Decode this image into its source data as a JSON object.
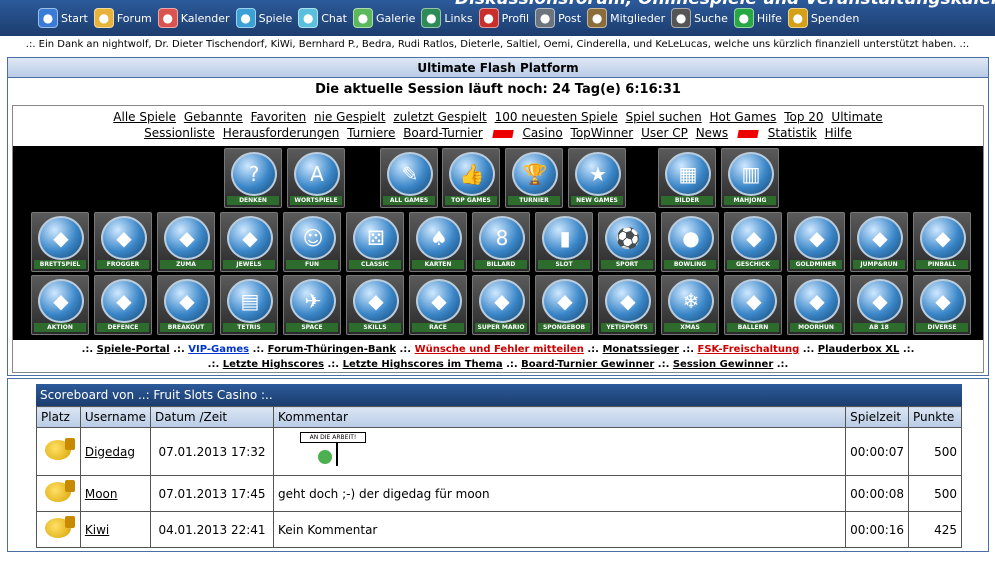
{
  "header": {
    "banner": "Diskussionsforum, Onlinespiele und Veranstaltungskalender für Thüringen",
    "nav": [
      {
        "label": "Start",
        "icon": "start-icon",
        "color": "#3a7bd5"
      },
      {
        "label": "Forum",
        "icon": "folder-icon",
        "color": "#e8b33a"
      },
      {
        "label": "Kalender",
        "icon": "calendar-icon",
        "color": "#d9534f"
      },
      {
        "label": "Spiele",
        "icon": "puzzle-icon",
        "color": "#3aa0d5"
      },
      {
        "label": "Chat",
        "icon": "chat-icon",
        "color": "#5bc0de"
      },
      {
        "label": "Galerie",
        "icon": "image-icon",
        "color": "#5cb85c"
      },
      {
        "label": "Links",
        "icon": "globe-icon",
        "color": "#2e8b57"
      },
      {
        "label": "Profil",
        "icon": "user-icon",
        "color": "#c9302c"
      },
      {
        "label": "Post",
        "icon": "mail-icon",
        "color": "#6c757d"
      },
      {
        "label": "Mitglieder",
        "icon": "members-icon",
        "color": "#8a6d3b"
      },
      {
        "label": "Suche",
        "icon": "binoculars-icon",
        "color": "#555"
      },
      {
        "label": "Hilfe",
        "icon": "help-icon",
        "color": "#28a745"
      },
      {
        "label": "Spenden",
        "icon": "coins-icon",
        "color": "#d4a017"
      }
    ]
  },
  "thanks": ".:. Ein Dank an nightwolf, Dr. Dieter Tischendorf, KiWi, Bernhard P., Bedra, Rudi Ratlos, Dieterle, Saltiel, Oemi, Cinderella, und KeLeLucas, welche uns kürzlich finanziell unterstützt haben. .:.",
  "main": {
    "title": "Ultimate Flash Platform",
    "session": "Die aktuelle Session läuft noch: 24 Tag(e) 6:16:31"
  },
  "links_row1": [
    "Alle Spiele",
    "Gebannte",
    "Favoriten",
    "nie Gespielt",
    "zuletzt Gespielt",
    "100 neuesten Spiele",
    "Spiel suchen",
    "Hot Games",
    "Top 20",
    "Ultimate"
  ],
  "links_row2": [
    "Sessionliste",
    "Herausforderungen",
    "Turniere",
    "Board-Turnier",
    "Casino",
    "TopWinner",
    "User CP",
    "News",
    "Statistik",
    "Hilfe"
  ],
  "games_row1": [
    "DENKEN",
    "WORTSPIELE",
    "ALL GAMES",
    "TOP GAMES",
    "TURNIER",
    "NEW GAMES",
    "BILDER",
    "MAHJONG"
  ],
  "games_row2": [
    "BRETTSPIEL",
    "FROGGER",
    "ZUMA",
    "JEWELS",
    "FUN",
    "CLASSIC",
    "KARTEN",
    "BILLARD",
    "SLOT",
    "SPORT",
    "BOWLING",
    "GESCHICK",
    "GOLDMINER",
    "JUMP&RUN",
    "PINBALL"
  ],
  "games_row3": [
    "AKTION",
    "DEFENCE",
    "BREAKOUT",
    "TETRIS",
    "SPACE",
    "SKILLS",
    "RACE",
    "SUPER MARIO",
    "SPONGEBOB",
    "YETISPORTS",
    "XMAS",
    "BALLERN",
    "MOORHUN",
    "AB 18",
    "DIVERSE"
  ],
  "footer1": [
    ".:. ",
    "Spiele-Portal",
    " .:. ",
    "VIP-Games",
    " .:. ",
    "Forum-Thüringen-Bank",
    " .:. ",
    "Wünsche und Fehler mitteilen",
    " .:. ",
    "Monatssieger",
    " .:. ",
    "FSK-Freischaltung",
    " .:. ",
    "Plauderbox XL",
    " .:."
  ],
  "footer2": [
    ".:. ",
    "Letzte Highscores",
    " .:. ",
    "Letzte Highscores im Thema",
    " .:. ",
    "Board-Turnier Gewinner",
    " .:. ",
    "Session Gewinner",
    " .:."
  ],
  "scoreboard": {
    "title": "Scoreboard von ..: Fruit Slots Casino :..",
    "headers": [
      "Platz",
      "Username",
      "Datum /Zeit",
      "Kommentar",
      "Spielzeit",
      "Punkte"
    ],
    "rows": [
      {
        "user": "Digedag",
        "date": "07.01.2013 17:32",
        "comment": "",
        "sign": "AN DIE ARBEIT!",
        "time": "00:00:07",
        "points": "500"
      },
      {
        "user": "Moon",
        "date": "07.01.2013 17:45",
        "comment": "geht doch ;-) der digedag für moon",
        "time": "00:00:08",
        "points": "500"
      },
      {
        "user": "Kiwi",
        "date": "04.01.2013 22:41",
        "comment": "Kein Kommentar",
        "time": "00:00:16",
        "points": "425"
      }
    ]
  }
}
